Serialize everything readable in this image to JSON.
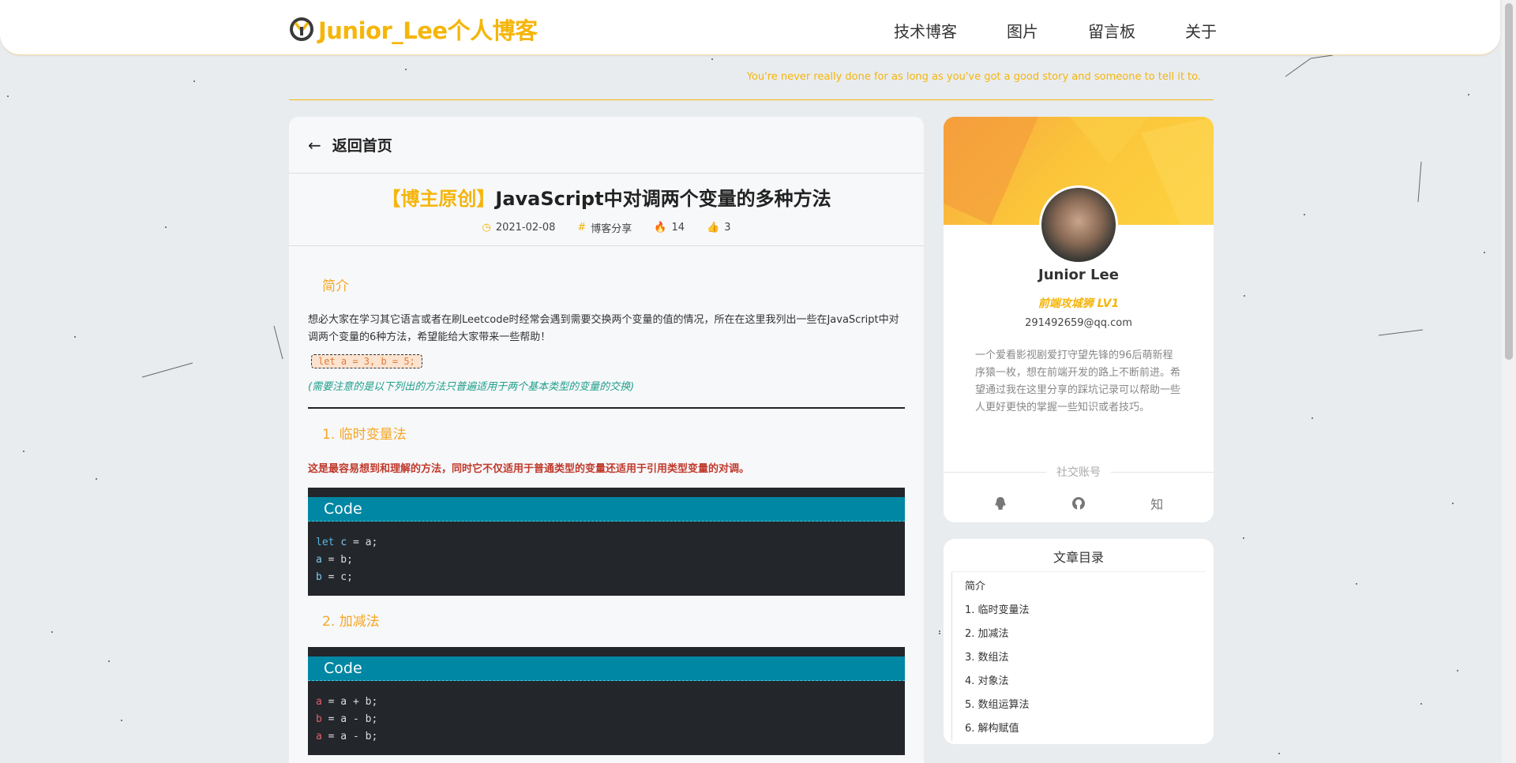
{
  "header": {
    "logo_text": "Junior_Lee个人博客",
    "nav": [
      "技术博客",
      "图片",
      "留言板",
      "关于"
    ]
  },
  "motto": "You're never really done for as long as you've got a good story and someone to tell it to.",
  "article": {
    "back_label": "返回首页",
    "title_tag": "【博主原创】",
    "title_text": "JavaScript中对调两个变量的多种方法",
    "meta": {
      "date": "2021-02-08",
      "category": "博客分享",
      "views": "14",
      "likes": "3"
    },
    "intro_heading": "简介",
    "intro_text": "想必大家在学习其它语言或者在刷Leetcode时经常会遇到需要交换两个变量的值的情况，所在在这里我列出一些在JavaScript中对调两个变量的6种方法，希望能给大家带来一些帮助！",
    "inline_code": "let a = 3, b = 5;",
    "note": "(需要注意的是以下列出的方法只普遍适用于两个基本类型的变量的交换)",
    "s1_heading": "1. 临时变量法",
    "s1_text": "这是最容易想到和理解的方法，同时它不仅适用于普通类型的变量还适用于引用类型变量的对调。",
    "code_label": "Code",
    "code1": [
      "let c = a;",
      "a = b;",
      "b = c;"
    ],
    "s2_heading": "2. 加减法",
    "code2": [
      "a = a + b;",
      "b = a - b;",
      "a = a - b;"
    ]
  },
  "profile": {
    "name": "Junior Lee",
    "title": "前端攻城狮 LV1",
    "email": "291492659@qq.com",
    "bio": "一个爱看影视剧爱打守望先锋的96后萌新程序猿一枚，想在前端开发的路上不断前进。希望通过我在这里分享的踩坑记录可以帮助一些人更好更快的掌握一些知识或者技巧。",
    "social_title": "社交账号",
    "social_icons": [
      "qq-icon",
      "github-icon",
      "zhihu-icon"
    ],
    "zhihu_glyph": "知"
  },
  "toc": {
    "title": "文章目录",
    "items": [
      "简介",
      "1. 临时变量法",
      "2. 加减法",
      "3. 数组法",
      "4. 对象法",
      "5. 数组运算法",
      "6. 解构赋值"
    ]
  },
  "colors": {
    "accent": "#f5b50a",
    "code_header": "#0087a3",
    "code_bg": "#23262b"
  }
}
